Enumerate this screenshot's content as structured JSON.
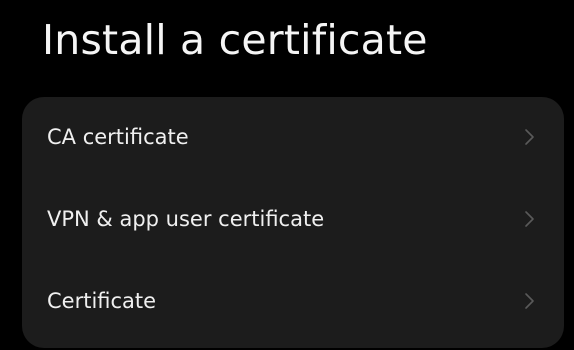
{
  "page": {
    "title": "Install a certificate"
  },
  "items": [
    {
      "label": "CA certificate",
      "icon": "chevron-right-icon"
    },
    {
      "label": "VPN & app user certificate",
      "icon": "chevron-right-icon"
    },
    {
      "label": "Certificate",
      "icon": "chevron-right-icon"
    }
  ],
  "colors": {
    "background": "#000000",
    "card": "#1c1c1c",
    "text": "#f0f0f0",
    "chevron": "#5a5a5a"
  }
}
